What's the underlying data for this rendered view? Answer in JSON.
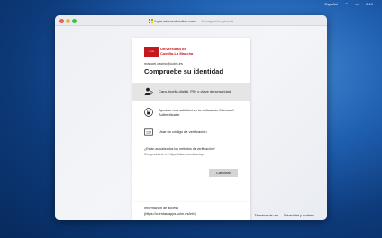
{
  "menubar": {
    "lang": "Español",
    "time": "8:19",
    "wifi_icon": "wifi-icon",
    "battery_icon": "battery-icon"
  },
  "browser": {
    "tab_url": "login.microsoftonline.com",
    "tab_mode": "— Navegación privada"
  },
  "org": {
    "name_line1": "Universidad de",
    "name_line2": "Castilla-La Mancha",
    "logo_text": "UCLM",
    "brand_color": "#c41a1f"
  },
  "account": "manuel.castro@uclm.es",
  "heading": "Compruebe su identidad",
  "options": [
    {
      "icon": "fingerprint-person-icon",
      "label": "Cara, huella digital, PIN o clave de seguridad"
    },
    {
      "icon": "authenticator-lock-icon",
      "label": "Aprobar una solicitud en la aplicación Microsoft Authenticator"
    },
    {
      "icon": "sms-code-icon",
      "label": "Usar un código de verificación"
    }
  ],
  "help": {
    "question": "¿Están actualizados los métodos de verificación?",
    "link": "Compruébelo en https://aka.ms/mfasetup"
  },
  "cancel_label": "Cancelar",
  "info": {
    "line1": "Información de acceso",
    "line2": "(https://cuentas.apps.uclm.es/info)"
  },
  "footer": {
    "terms": "Términos de uso",
    "privacy": "Privacidad y cookies",
    "more": "..."
  }
}
